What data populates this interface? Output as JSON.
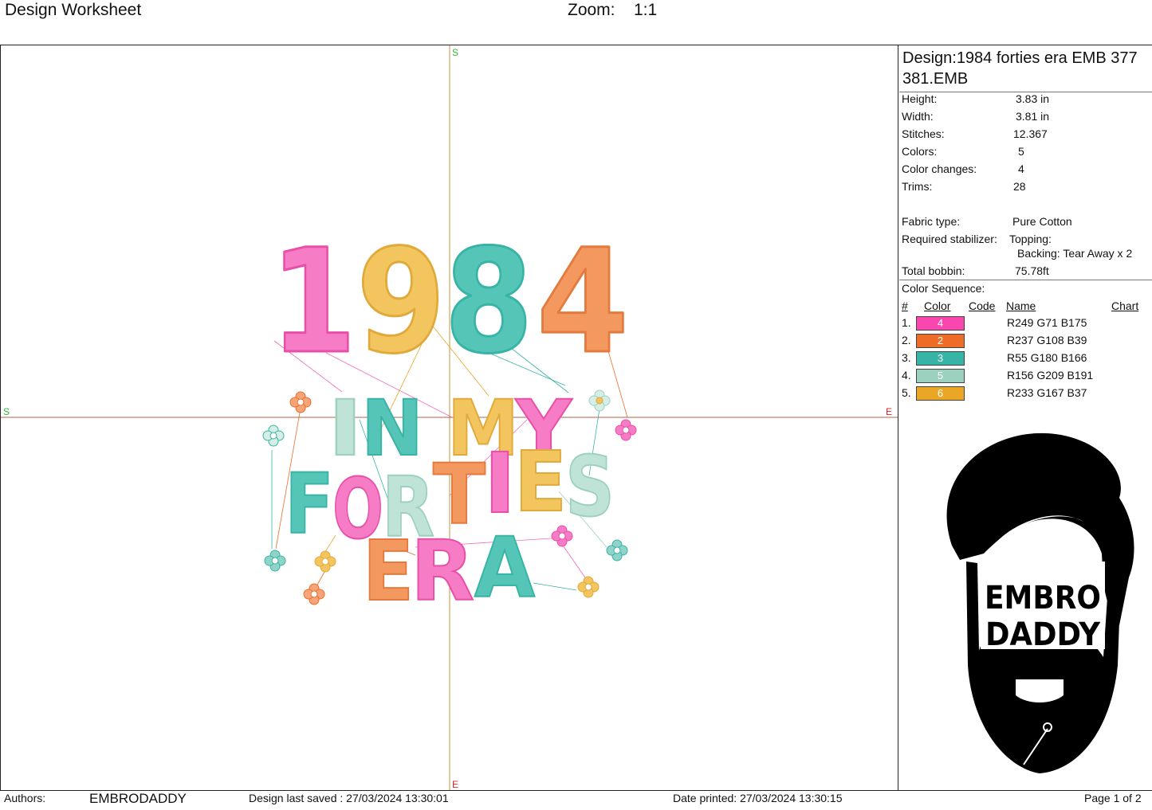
{
  "header": {
    "title": "Design Worksheet",
    "zoom_label": "Zoom:",
    "zoom_value": "1:1"
  },
  "canvas": {
    "markers": {
      "start": "S",
      "end": "E"
    },
    "artwork_text": {
      "year": "1984",
      "line1": "IN MY",
      "line2": "FORTIES",
      "line3": "ERA"
    }
  },
  "design": {
    "name": "Design:1984 forties era EMB 377 381.EMB",
    "stats": [
      {
        "label": "Height:",
        "value": "3.83 in"
      },
      {
        "label": "Width:",
        "value": "3.81 in"
      },
      {
        "label": "Stitches:",
        "value": "12.367"
      },
      {
        "label": "Colors:",
        "value": "5"
      },
      {
        "label": "Color changes:",
        "value": "4"
      },
      {
        "label": "Trims:",
        "value": "28"
      }
    ],
    "fabric_label": "Fabric type:",
    "fabric_value": "Pure Cotton",
    "stabilizer_label": "Required stabilizer:",
    "topping": "Topping:",
    "backing": "Backing: Tear Away x 2",
    "bobbin_label": "Total bobbin:",
    "bobbin_value": "75.78ft"
  },
  "color_sequence": {
    "title": "Color Sequence:",
    "headers": {
      "num": "#",
      "color": "Color",
      "code": "Code",
      "name": "Name",
      "chart": "Chart"
    },
    "rows": [
      {
        "num": "1.",
        "code": "4",
        "name": "R249 G71 B175",
        "hex": "#F947AF"
      },
      {
        "num": "2.",
        "code": "2",
        "name": "R237 G108 B39",
        "hex": "#ED6C27"
      },
      {
        "num": "3.",
        "code": "3",
        "name": "R55 G180 B166",
        "hex": "#37B4A6"
      },
      {
        "num": "4.",
        "code": "5",
        "name": "R156 G209 B191",
        "hex": "#9CD1BF"
      },
      {
        "num": "5.",
        "code": "6",
        "name": "R233 G167 B37",
        "hex": "#E9A725"
      }
    ]
  },
  "logo": {
    "line1": "EMBRO",
    "line2": "DADDY"
  },
  "footer": {
    "authors_label": "Authors:",
    "authors_value": "EMBRODADDY",
    "saved": "Design last saved : 27/03/2024 13:30:01",
    "printed": "Date printed: 27/03/2024 13:30:15",
    "page": "Page 1 of 2"
  }
}
